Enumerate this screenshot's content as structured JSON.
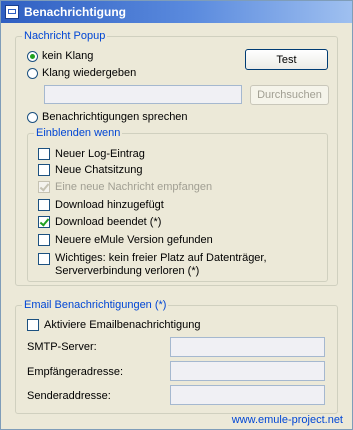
{
  "window": {
    "title": "Benachrichtigung"
  },
  "popup": {
    "legend": "Nachricht Popup",
    "no_sound": "kein Klang",
    "play_sound": "Klang wiedergeben",
    "test_button": "Test",
    "sound_path": "",
    "browse_button": "Durchsuchen",
    "speak": "Benachrichtigungen sprechen",
    "selected_mode": "kein Klang"
  },
  "show_when": {
    "legend": "Einblenden wenn",
    "items": [
      {
        "label": "Neuer Log-Eintrag",
        "checked": false,
        "disabled": false
      },
      {
        "label": "Neue Chatsitzung",
        "checked": false,
        "disabled": false
      },
      {
        "label": "Eine neue Nachricht empfangen",
        "checked": true,
        "disabled": true
      },
      {
        "label": "Download hinzugefügt",
        "checked": false,
        "disabled": false
      },
      {
        "label": "Download beendet (*)",
        "checked": true,
        "disabled": false
      },
      {
        "label": "Neuere eMule Version gefunden",
        "checked": false,
        "disabled": false
      },
      {
        "label": "Wichtiges: kein freier Platz auf Datenträger, Serververbindung verloren (*)",
        "checked": false,
        "disabled": false
      }
    ]
  },
  "email": {
    "legend": "Email Benachrichtigungen (*)",
    "activate": "Aktiviere Emailbenachrichtigung",
    "smtp_label": "SMTP-Server:",
    "smtp_value": "",
    "recipient_label": "Empfängeradresse:",
    "recipient_value": "",
    "sender_label": "Senderaddresse:",
    "sender_value": ""
  },
  "footer": {
    "link": "www.emule-project.net"
  },
  "colors": {
    "accent": "#0046d5",
    "title_start": "#2f5fc2",
    "check_green": "#21a121"
  }
}
